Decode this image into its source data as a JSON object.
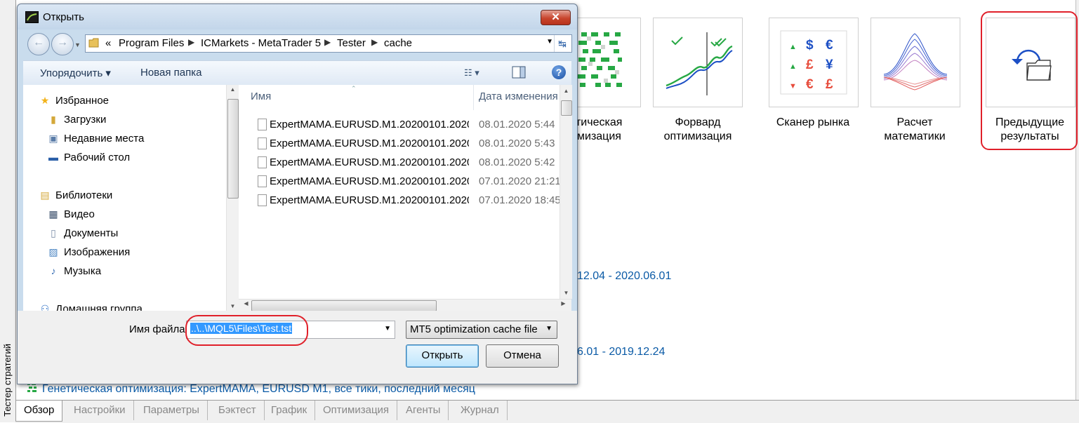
{
  "background": {
    "side_tab": "Тестер стратегий",
    "tiles": [
      {
        "label": "етическая\nимизация",
        "icon": "genetic-grid-icon"
      },
      {
        "label": "Форвард\nоптимизация",
        "icon": "forward-chart-icon"
      },
      {
        "label": "Сканер рынка",
        "icon": "currency-scanner-icon"
      },
      {
        "label": "Расчет\nматематики",
        "icon": "math-surface-icon"
      },
      {
        "label": "Предыдущие\nрезультаты",
        "icon": "previous-results-icon"
      }
    ],
    "links": [
      "12.04 - 2020.06.01",
      "6.01 - 2019.12.24"
    ],
    "bottom_line": "Генетическая оптимизация: ExpertMAMA, EURUSD M1, все тики, последний месяц",
    "tabs": [
      "Обзор",
      "Настройки",
      "Параметры",
      "Бэктест",
      "График",
      "Оптимизация",
      "Агенты",
      "Журнал"
    ],
    "active_tab": "Обзор"
  },
  "dialog": {
    "title": "Открыть",
    "close_glyph": "✕",
    "breadcrumb": {
      "overflow": "«",
      "items": [
        "Program Files",
        "ICMarkets - MetaTrader 5",
        "Tester",
        "cache"
      ]
    },
    "toolbar": {
      "organize": "Упорядочить ▾",
      "new_folder": "Новая папка",
      "help": "?"
    },
    "nav": {
      "favorites": "Избранное",
      "downloads": "Загрузки",
      "recent": "Недавние места",
      "desktop": "Рабочий стол",
      "libraries": "Библиотеки",
      "video": "Видео",
      "documents": "Документы",
      "images": "Изображения",
      "music": "Музыка",
      "homegroup": "Домашняя группа"
    },
    "columns": {
      "name": "Имя",
      "date": "Дата изменения"
    },
    "files": [
      {
        "name": "ExpertMAMA.EURUSD.M1.20200101.2020...",
        "date": "08.01.2020 5:44"
      },
      {
        "name": "ExpertMAMA.EURUSD.M1.20200101.2020...",
        "date": "08.01.2020 5:43"
      },
      {
        "name": "ExpertMAMA.EURUSD.M1.20200101.2020...",
        "date": "08.01.2020 5:42"
      },
      {
        "name": "ExpertMAMA.EURUSD.M1.20200101.2020...",
        "date": "07.01.2020 21:21"
      },
      {
        "name": "ExpertMAMA.EURUSD.M1.20200101.2020...",
        "date": "07.01.2020 18:45"
      }
    ],
    "filename_label": "Имя файла:",
    "filename_value": "..\\..\\MQL5\\Files\\Test.tst",
    "filetype": "MT5 optimization cache file",
    "open_button": "Открыть",
    "cancel_button": "Отмена"
  },
  "colors": {
    "highlight": "#e0202a",
    "link": "#0a5aa6",
    "selection": "#3399ff"
  }
}
